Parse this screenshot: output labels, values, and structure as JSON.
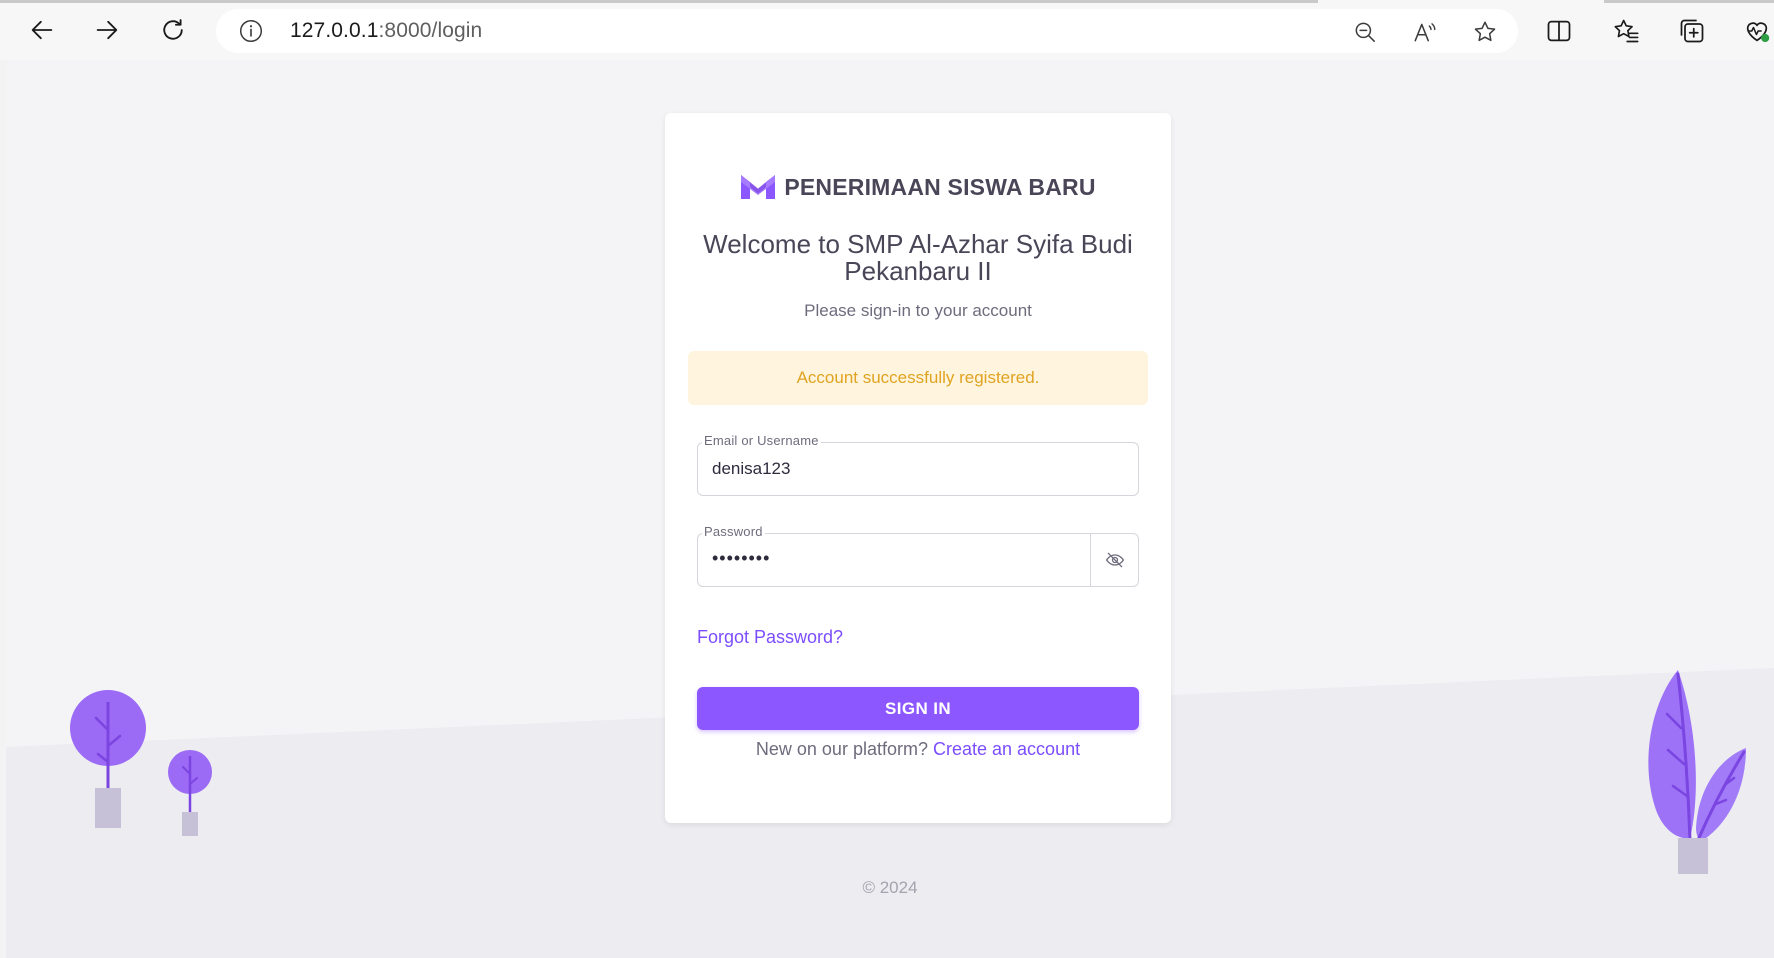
{
  "browser": {
    "url_host": "127.0.0.1",
    "url_rest": ":8000/login"
  },
  "brand": {
    "name": "PENERIMAAN SISWA BARU",
    "color": "#8c57ff"
  },
  "login": {
    "welcome": "Welcome to SMP Al-Azhar Syifa Budi Pekanbaru II",
    "subtitle": "Please sign-in to your account",
    "alert": "Account successfully registered.",
    "email_label": "Email or Username",
    "email_value": "denisa123",
    "password_label": "Password",
    "password_value": "••••••••",
    "forgot": "Forgot Password?",
    "signin_label": "SIGN IN",
    "new_text": "New on our platform?",
    "create_link": "Create an account"
  },
  "footer": {
    "copyright": "© 2024"
  },
  "colors": {
    "primary": "#8c57ff",
    "alert_bg": "#fff4dd",
    "alert_text": "#e0a422",
    "text": "#4a4658"
  }
}
